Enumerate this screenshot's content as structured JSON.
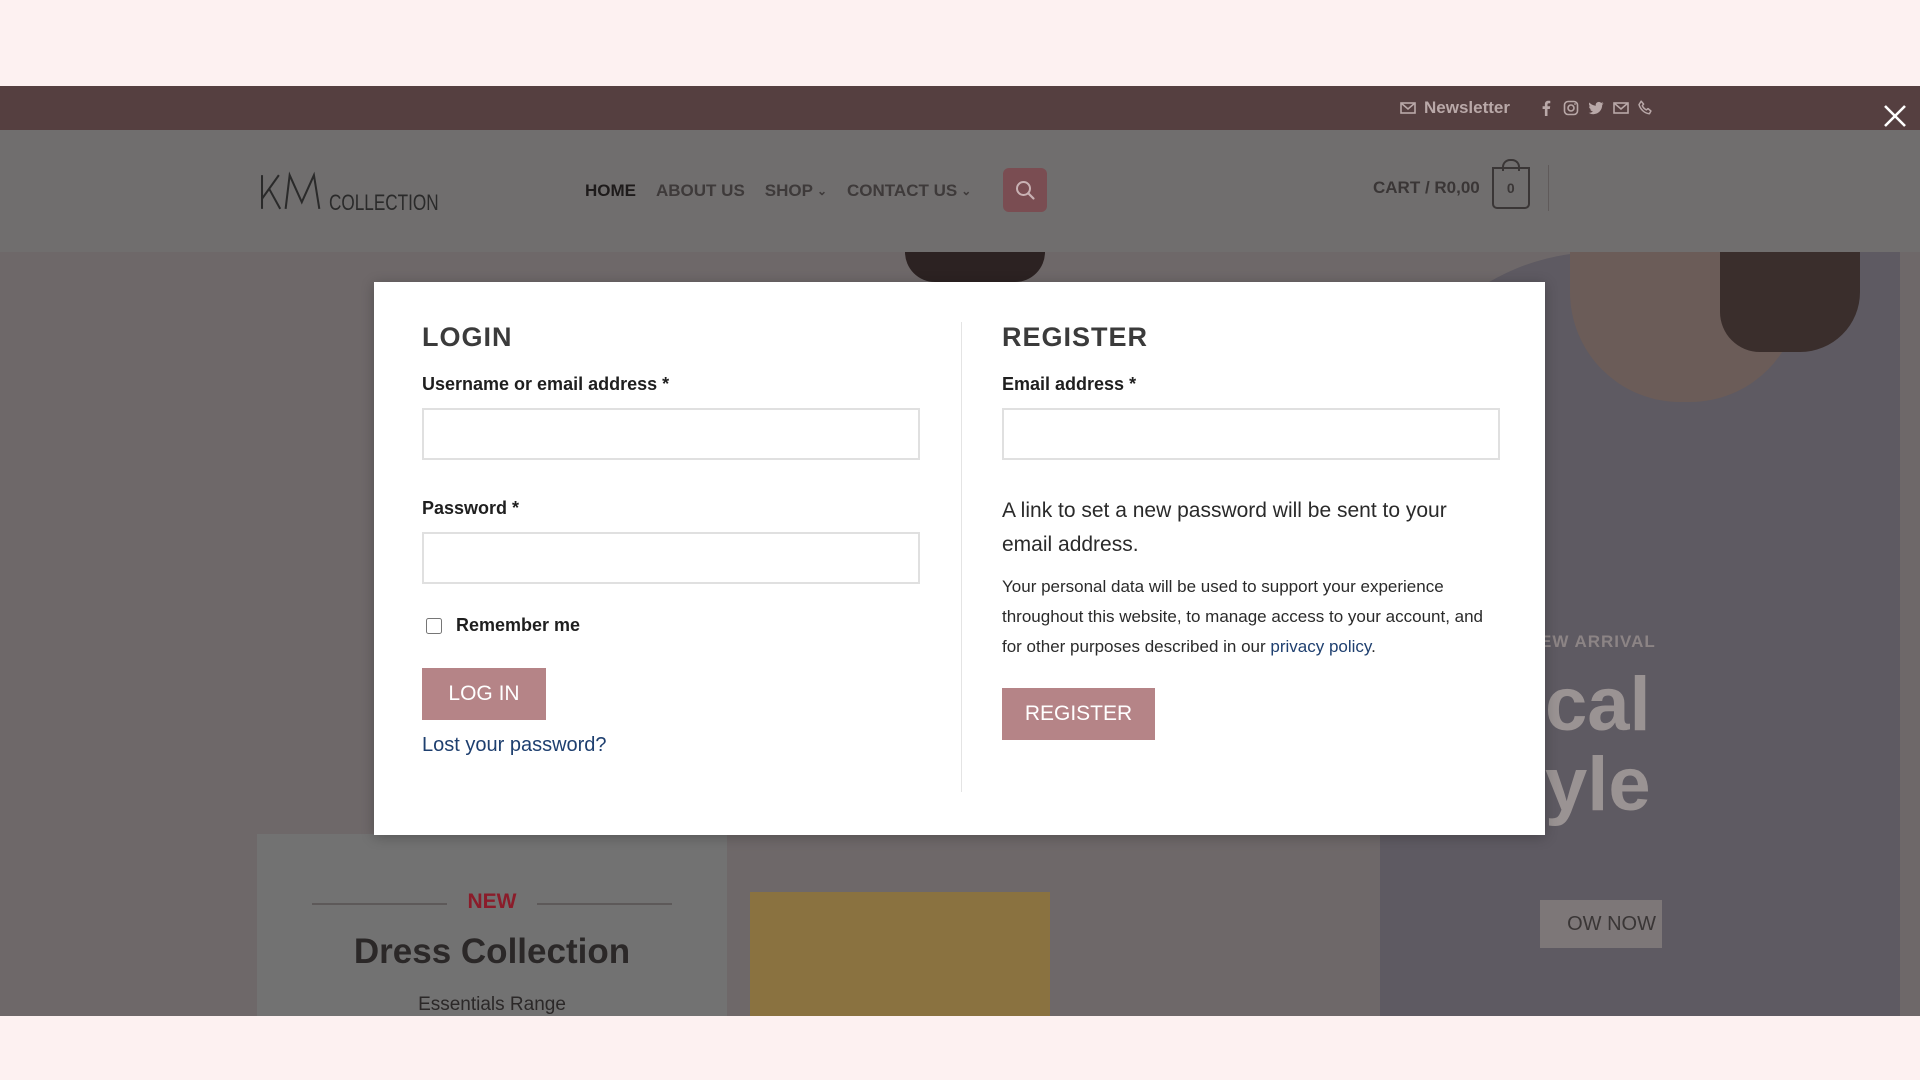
{
  "topbar": {
    "newsletter_label": "Newsletter",
    "social_icons": [
      "facebook-icon",
      "instagram-icon",
      "twitter-icon",
      "mail-icon",
      "phone-icon"
    ]
  },
  "header": {
    "logo_text": "COLLECTION",
    "nav": [
      {
        "label": "HOME",
        "active": true
      },
      {
        "label": "ABOUT US"
      },
      {
        "label": "SHOP",
        "dropdown": true
      },
      {
        "label": "CONTACT US",
        "dropdown": true
      }
    ],
    "cart_label": "CART / R0,00",
    "cart_count": "0"
  },
  "hero": {
    "eyebrow": "EW ARRIVAL",
    "line1": "cal",
    "line2": "yle",
    "button": "OW NOW"
  },
  "dress_card": {
    "badge": "NEW",
    "title": "Dress Collection",
    "subtitle": "Essentials Range"
  },
  "login": {
    "heading": "LOGIN",
    "username_label": "Username or email address *",
    "username_value": "",
    "password_label": "Password *",
    "password_value": "",
    "remember_label": "Remember me",
    "remember_checked": false,
    "submit_label": "LOG IN",
    "lost_password_label": "Lost your password?"
  },
  "register": {
    "heading": "REGISTER",
    "email_label": "Email address *",
    "email_value": "",
    "note": "A link to set a new password will be sent to your email address.",
    "privacy_text": "Your personal data will be used to support your experience throughout this website, to manage access to your account, and for other purposes described in our",
    "privacy_link": "privacy policy",
    "privacy_end": ".",
    "submit_label": "REGISTER"
  },
  "colors": {
    "accent": "#b58487",
    "link": "#1e3f6f",
    "topbar": "#553f40",
    "search_button": "#7a4d52"
  }
}
